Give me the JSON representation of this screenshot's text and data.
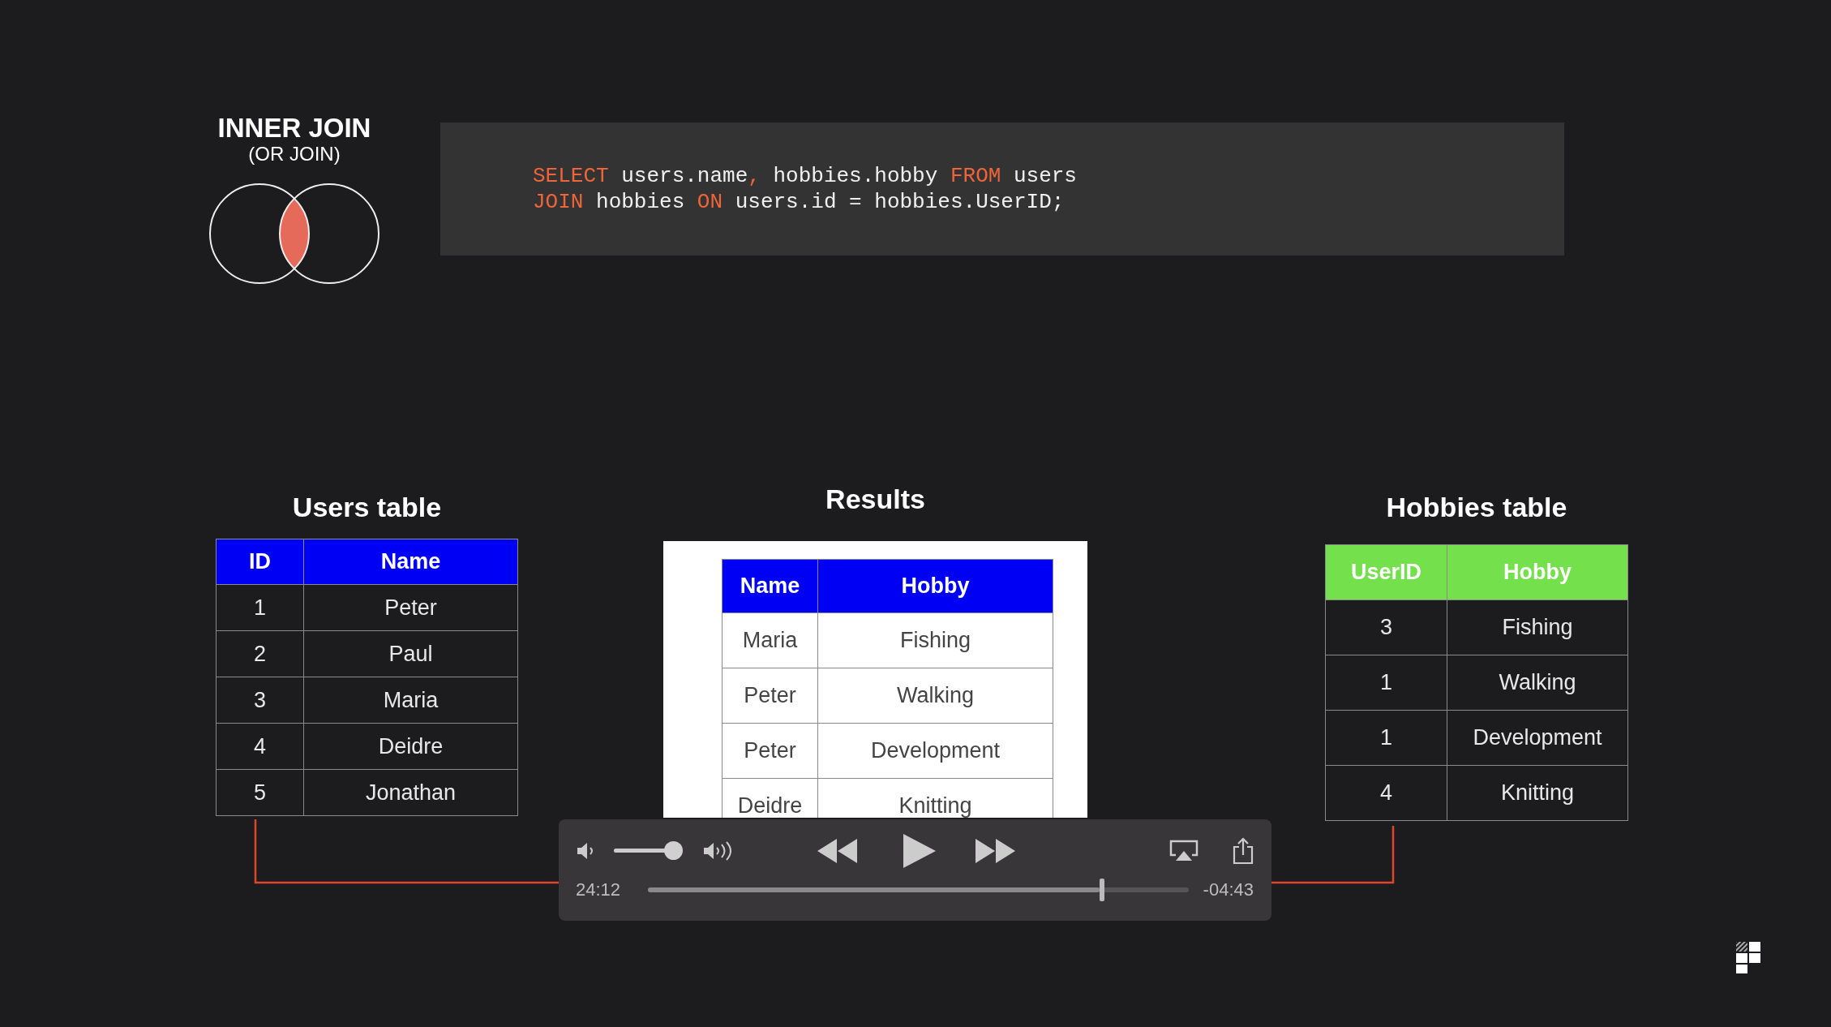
{
  "join": {
    "title": "INNER JOIN",
    "subtitle": "(OR JOIN)"
  },
  "code": [
    [
      {
        "text": "SELECT",
        "keyword": true
      },
      {
        "text": " users.name",
        "keyword": false
      },
      {
        "text": ",",
        "keyword": true
      },
      {
        "text": " hobbies.hobby ",
        "keyword": false
      },
      {
        "text": "FROM",
        "keyword": true
      },
      {
        "text": " users",
        "keyword": false
      }
    ],
    [
      {
        "text": "JOIN",
        "keyword": true
      },
      {
        "text": " hobbies ",
        "keyword": false
      },
      {
        "text": "ON",
        "keyword": true
      },
      {
        "text": " users.id = hobbies.UserID;",
        "keyword": false
      }
    ]
  ],
  "tables": [
    {
      "title": "Users table",
      "color": "#0000f5",
      "columns": [
        "ID",
        "Name"
      ],
      "rows": [
        [
          "1",
          "Peter"
        ],
        [
          "2",
          "Paul"
        ],
        [
          "3",
          "Maria"
        ],
        [
          "4",
          "Deidre"
        ],
        [
          "5",
          "Jonathan"
        ]
      ]
    },
    {
      "title": "Results",
      "color": "#0000f5",
      "columns": [
        "Name",
        "Hobby"
      ],
      "rows": [
        [
          "Maria",
          "Fishing"
        ],
        [
          "Peter",
          "Walking"
        ],
        [
          "Peter",
          "Development"
        ],
        [
          "Deidre",
          "Knitting"
        ]
      ]
    },
    {
      "title": "Hobbies table",
      "color": "#73e04c",
      "columns": [
        "UserID",
        "Hobby"
      ],
      "rows": [
        [
          "3",
          "Fishing"
        ],
        [
          "1",
          "Walking"
        ],
        [
          "1",
          "Development"
        ],
        [
          "4",
          "Knitting"
        ]
      ]
    }
  ],
  "player": {
    "playing": false,
    "volume": {
      "level": 0.95
    },
    "progress": {
      "level": 0.835
    },
    "elapsed": "24:12",
    "remaining": "-04:43"
  }
}
